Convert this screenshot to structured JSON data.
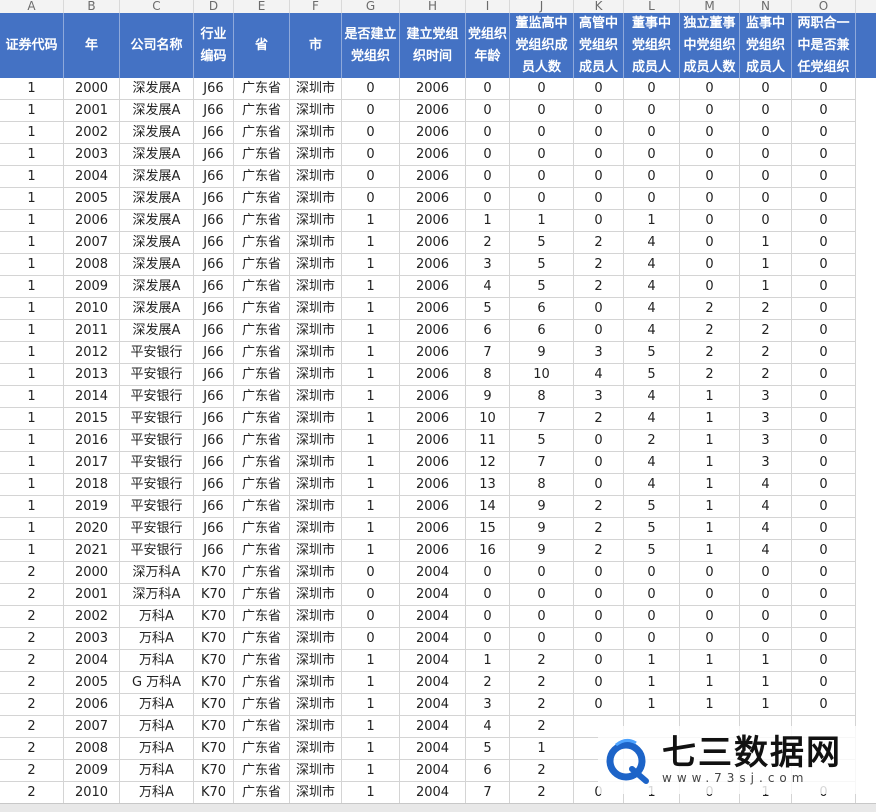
{
  "columns": [
    {
      "letter": "A",
      "header": "证券代码"
    },
    {
      "letter": "B",
      "header": "年"
    },
    {
      "letter": "C",
      "header": "公司名称"
    },
    {
      "letter": "D",
      "header": "行业编码"
    },
    {
      "letter": "E",
      "header": "省"
    },
    {
      "letter": "F",
      "header": "市"
    },
    {
      "letter": "G",
      "header": "是否建立党组织"
    },
    {
      "letter": "H",
      "header": "建立党组织时间"
    },
    {
      "letter": "I",
      "header": "党组织年龄"
    },
    {
      "letter": "J",
      "header": "董监高中党组织成员人数"
    },
    {
      "letter": "K",
      "header": "高管中党组织成员人"
    },
    {
      "letter": "L",
      "header": "董事中党组织成员人"
    },
    {
      "letter": "M",
      "header": "独立董事中党组织成员人数"
    },
    {
      "letter": "N",
      "header": "监事中党组织成员人"
    },
    {
      "letter": "O",
      "header": "两职合一中是否兼任党组织"
    }
  ],
  "rows": [
    [
      "1",
      "2000",
      "深发展A",
      "J66",
      "广东省",
      "深圳市",
      "0",
      "2006",
      "0",
      "0",
      "0",
      "0",
      "0",
      "0",
      "0"
    ],
    [
      "1",
      "2001",
      "深发展A",
      "J66",
      "广东省",
      "深圳市",
      "0",
      "2006",
      "0",
      "0",
      "0",
      "0",
      "0",
      "0",
      "0"
    ],
    [
      "1",
      "2002",
      "深发展A",
      "J66",
      "广东省",
      "深圳市",
      "0",
      "2006",
      "0",
      "0",
      "0",
      "0",
      "0",
      "0",
      "0"
    ],
    [
      "1",
      "2003",
      "深发展A",
      "J66",
      "广东省",
      "深圳市",
      "0",
      "2006",
      "0",
      "0",
      "0",
      "0",
      "0",
      "0",
      "0"
    ],
    [
      "1",
      "2004",
      "深发展A",
      "J66",
      "广东省",
      "深圳市",
      "0",
      "2006",
      "0",
      "0",
      "0",
      "0",
      "0",
      "0",
      "0"
    ],
    [
      "1",
      "2005",
      "深发展A",
      "J66",
      "广东省",
      "深圳市",
      "0",
      "2006",
      "0",
      "0",
      "0",
      "0",
      "0",
      "0",
      "0"
    ],
    [
      "1",
      "2006",
      "深发展A",
      "J66",
      "广东省",
      "深圳市",
      "1",
      "2006",
      "1",
      "1",
      "0",
      "1",
      "0",
      "0",
      "0"
    ],
    [
      "1",
      "2007",
      "深发展A",
      "J66",
      "广东省",
      "深圳市",
      "1",
      "2006",
      "2",
      "5",
      "2",
      "4",
      "0",
      "1",
      "0"
    ],
    [
      "1",
      "2008",
      "深发展A",
      "J66",
      "广东省",
      "深圳市",
      "1",
      "2006",
      "3",
      "5",
      "2",
      "4",
      "0",
      "1",
      "0"
    ],
    [
      "1",
      "2009",
      "深发展A",
      "J66",
      "广东省",
      "深圳市",
      "1",
      "2006",
      "4",
      "5",
      "2",
      "4",
      "0",
      "1",
      "0"
    ],
    [
      "1",
      "2010",
      "深发展A",
      "J66",
      "广东省",
      "深圳市",
      "1",
      "2006",
      "5",
      "6",
      "0",
      "4",
      "2",
      "2",
      "0"
    ],
    [
      "1",
      "2011",
      "深发展A",
      "J66",
      "广东省",
      "深圳市",
      "1",
      "2006",
      "6",
      "6",
      "0",
      "4",
      "2",
      "2",
      "0"
    ],
    [
      "1",
      "2012",
      "平安银行",
      "J66",
      "广东省",
      "深圳市",
      "1",
      "2006",
      "7",
      "9",
      "3",
      "5",
      "2",
      "2",
      "0"
    ],
    [
      "1",
      "2013",
      "平安银行",
      "J66",
      "广东省",
      "深圳市",
      "1",
      "2006",
      "8",
      "10",
      "4",
      "5",
      "2",
      "2",
      "0"
    ],
    [
      "1",
      "2014",
      "平安银行",
      "J66",
      "广东省",
      "深圳市",
      "1",
      "2006",
      "9",
      "8",
      "3",
      "4",
      "1",
      "3",
      "0"
    ],
    [
      "1",
      "2015",
      "平安银行",
      "J66",
      "广东省",
      "深圳市",
      "1",
      "2006",
      "10",
      "7",
      "2",
      "4",
      "1",
      "3",
      "0"
    ],
    [
      "1",
      "2016",
      "平安银行",
      "J66",
      "广东省",
      "深圳市",
      "1",
      "2006",
      "11",
      "5",
      "0",
      "2",
      "1",
      "3",
      "0"
    ],
    [
      "1",
      "2017",
      "平安银行",
      "J66",
      "广东省",
      "深圳市",
      "1",
      "2006",
      "12",
      "7",
      "0",
      "4",
      "1",
      "3",
      "0"
    ],
    [
      "1",
      "2018",
      "平安银行",
      "J66",
      "广东省",
      "深圳市",
      "1",
      "2006",
      "13",
      "8",
      "0",
      "4",
      "1",
      "4",
      "0"
    ],
    [
      "1",
      "2019",
      "平安银行",
      "J66",
      "广东省",
      "深圳市",
      "1",
      "2006",
      "14",
      "9",
      "2",
      "5",
      "1",
      "4",
      "0"
    ],
    [
      "1",
      "2020",
      "平安银行",
      "J66",
      "广东省",
      "深圳市",
      "1",
      "2006",
      "15",
      "9",
      "2",
      "5",
      "1",
      "4",
      "0"
    ],
    [
      "1",
      "2021",
      "平安银行",
      "J66",
      "广东省",
      "深圳市",
      "1",
      "2006",
      "16",
      "9",
      "2",
      "5",
      "1",
      "4",
      "0"
    ],
    [
      "2",
      "2000",
      "深万科A",
      "K70",
      "广东省",
      "深圳市",
      "0",
      "2004",
      "0",
      "0",
      "0",
      "0",
      "0",
      "0",
      "0"
    ],
    [
      "2",
      "2001",
      "深万科A",
      "K70",
      "广东省",
      "深圳市",
      "0",
      "2004",
      "0",
      "0",
      "0",
      "0",
      "0",
      "0",
      "0"
    ],
    [
      "2",
      "2002",
      "万科A",
      "K70",
      "广东省",
      "深圳市",
      "0",
      "2004",
      "0",
      "0",
      "0",
      "0",
      "0",
      "0",
      "0"
    ],
    [
      "2",
      "2003",
      "万科A",
      "K70",
      "广东省",
      "深圳市",
      "0",
      "2004",
      "0",
      "0",
      "0",
      "0",
      "0",
      "0",
      "0"
    ],
    [
      "2",
      "2004",
      "万科A",
      "K70",
      "广东省",
      "深圳市",
      "1",
      "2004",
      "1",
      "2",
      "0",
      "1",
      "1",
      "1",
      "0"
    ],
    [
      "2",
      "2005",
      "G 万科A",
      "K70",
      "广东省",
      "深圳市",
      "1",
      "2004",
      "2",
      "2",
      "0",
      "1",
      "1",
      "1",
      "0"
    ],
    [
      "2",
      "2006",
      "万科A",
      "K70",
      "广东省",
      "深圳市",
      "1",
      "2004",
      "3",
      "2",
      "0",
      "1",
      "1",
      "1",
      "0"
    ],
    [
      "2",
      "2007",
      "万科A",
      "K70",
      "广东省",
      "深圳市",
      "1",
      "2004",
      "4",
      "2",
      "",
      "",
      "",
      "",
      ""
    ],
    [
      "2",
      "2008",
      "万科A",
      "K70",
      "广东省",
      "深圳市",
      "1",
      "2004",
      "5",
      "1",
      "",
      "",
      "",
      "",
      ""
    ],
    [
      "2",
      "2009",
      "万科A",
      "K70",
      "广东省",
      "深圳市",
      "1",
      "2004",
      "6",
      "2",
      "",
      "",
      "",
      "",
      ""
    ],
    [
      "2",
      "2010",
      "万科A",
      "K70",
      "广东省",
      "深圳市",
      "1",
      "2004",
      "7",
      "2",
      "0",
      "1",
      "0",
      "1",
      "0"
    ]
  ],
  "watermark": {
    "title": "七三数据网",
    "url": "www.73sj.com",
    "logo_icon": "blue-letter-q-dragon-icon"
  },
  "colors": {
    "header_bg": "#4472c4",
    "header_text": "#ffffff",
    "grid": "#d4d4d4"
  }
}
